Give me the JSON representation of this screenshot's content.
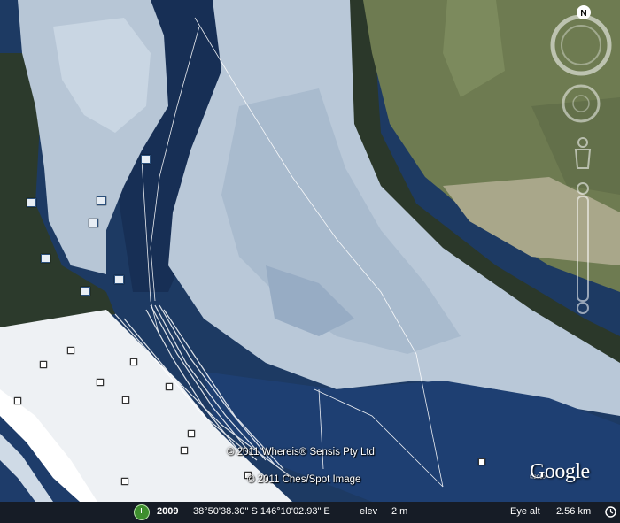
{
  "map": {
    "copyright_lines": [
      "© 2011 Whereis® Sensis Pty Ltd",
      "© 2011 Cnes/Spot Image"
    ],
    "logo": "Google",
    "logo_year": "©2010"
  },
  "status_bar": {
    "imagery_year": "2009",
    "coordinates": "38°50'38.30\" S  146°10'02.93\" E",
    "elev_label": "elev",
    "elevation": "2 m",
    "eye_alt_label": "Eye alt",
    "eye_alt_value": "2.56 km"
  },
  "navigation": {
    "north_label": "N"
  },
  "colors": {
    "water_deep": "#1d3e6e",
    "sand_flat": "#b9c8d8",
    "beach": "#f2f4f6",
    "farmland": "#6f7d52",
    "vegetation": "#2e3b2a"
  }
}
